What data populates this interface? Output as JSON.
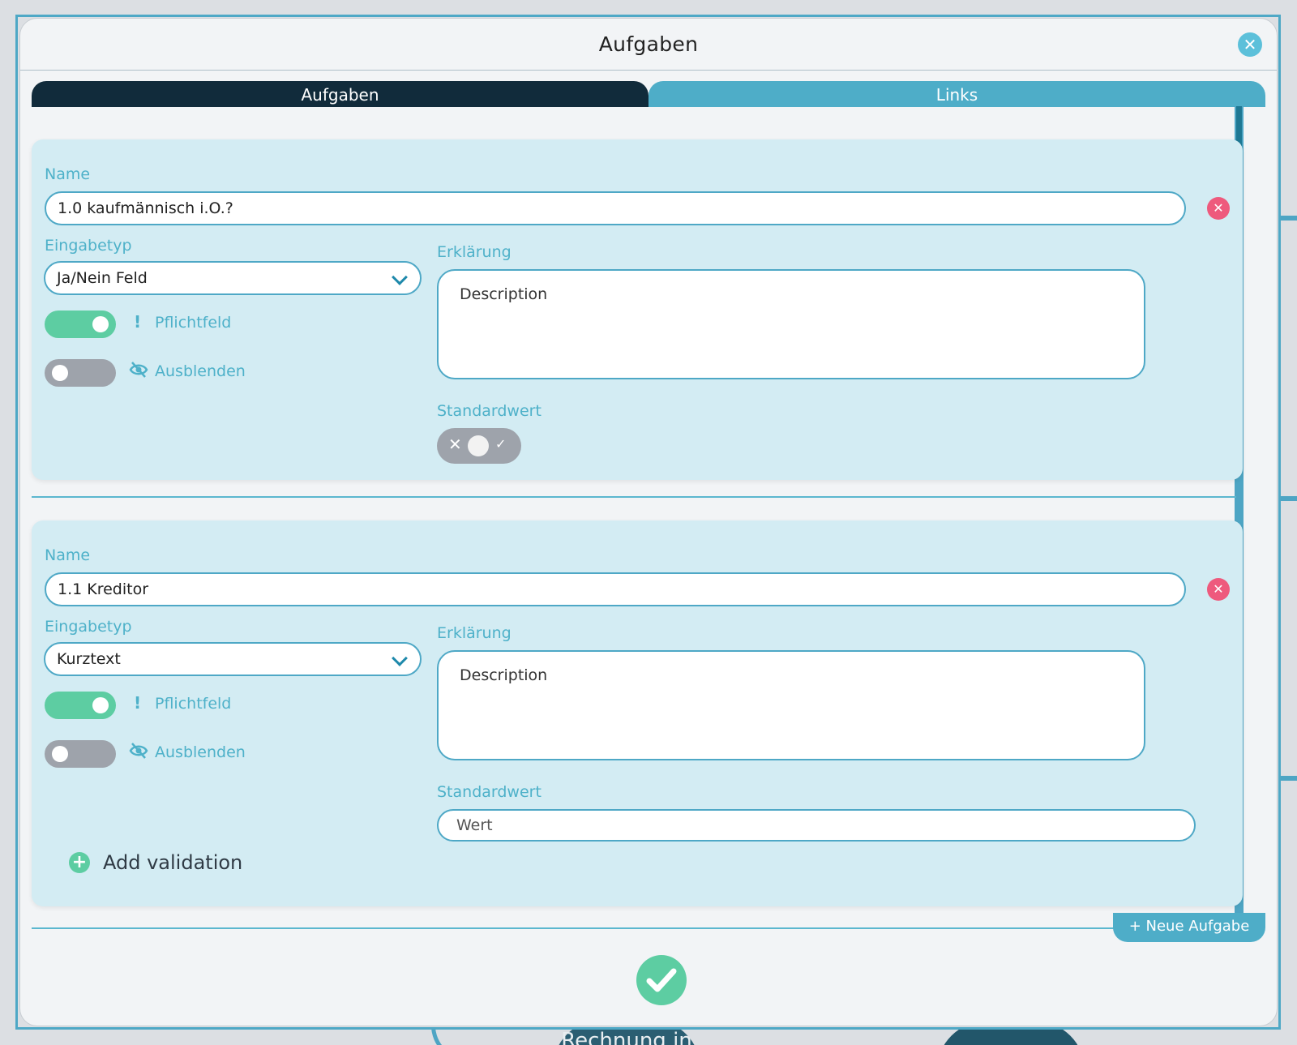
{
  "modal": {
    "title": "Aufgaben",
    "close_icon": "close-icon"
  },
  "tabs": [
    {
      "label": "Aufgaben",
      "active": true
    },
    {
      "label": "Links",
      "active": false
    }
  ],
  "tasks": [
    {
      "name_label": "Name",
      "name_value": "1.0 kaufmännisch i.O.?",
      "type_label": "Eingabetyp",
      "type_value": "Ja/Nein Feld",
      "required_label": "Pflichtfeld",
      "required_on": true,
      "hide_label": "Ausblenden",
      "hide_on": false,
      "explanation_label": "Erklärung",
      "explanation_placeholder": "Description",
      "default_label": "Standardwert",
      "default_symbols": {
        "no": "✕",
        "yes": "✓"
      }
    },
    {
      "name_label": "Name",
      "name_value": "1.1 Kreditor",
      "type_label": "Eingabetyp",
      "type_value": "Kurztext",
      "required_label": "Pflichtfeld",
      "required_on": true,
      "hide_label": "Ausblenden",
      "hide_on": false,
      "explanation_label": "Erklärung",
      "explanation_placeholder": "Description",
      "default_label": "Standardwert",
      "default_placeholder": "Wert",
      "add_validation_label": "Add validation"
    }
  ],
  "actions": {
    "new_task_label": "+ Neue Aufgabe",
    "confirm_icon": "check-icon"
  },
  "background": {
    "node_label": "Rechnung in"
  },
  "colors": {
    "accent": "#4eadc8",
    "tab_active": "#112b3b",
    "toggle_on": "#5dcda2",
    "toggle_off": "#9ea3ab",
    "remove": "#ee5a7d",
    "card_bg": "#d3ecf3"
  }
}
